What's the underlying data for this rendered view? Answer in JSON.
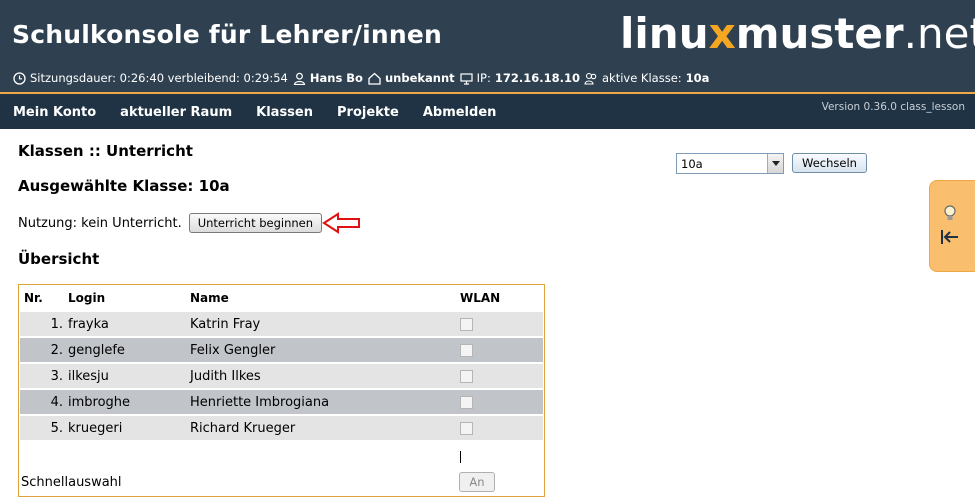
{
  "header": {
    "title": "Schulkonsole für Lehrer/innen",
    "logo": {
      "part1": "linu",
      "x": "x",
      "part2": "muster",
      "part3": ".net"
    },
    "status": {
      "session_label": "Sitzungsdauer: 0:26:40 verbleibend: 0:29:54",
      "user": "Hans Bo",
      "room": "unbekannt",
      "ip_label": "IP:",
      "ip": "172.16.18.10",
      "class_label": "aktive Klasse:",
      "class": "10a"
    }
  },
  "nav": {
    "items": [
      "Mein Konto",
      "aktueller Raum",
      "Klassen",
      "Projekte",
      "Abmelden"
    ],
    "version": "Version 0.36.0 class_lesson"
  },
  "page": {
    "title": "Klassen :: Unterricht",
    "selected_class": "Ausgewählte Klasse: 10a",
    "usage_text": "Nutzung: kein Unterricht.",
    "start_button": "Unterricht beginnen",
    "overview_heading": "Übersicht",
    "class_select_value": "10a",
    "switch_button": "Wechseln"
  },
  "table": {
    "headers": [
      "Nr.",
      "Login",
      "Name",
      "WLAN"
    ],
    "rows": [
      {
        "nr": "1.",
        "login": "frayka",
        "name": "Katrin Fray"
      },
      {
        "nr": "2.",
        "login": "genglefe",
        "name": "Felix Gengler"
      },
      {
        "nr": "3.",
        "login": "ilkesju",
        "name": "Judith Ilkes"
      },
      {
        "nr": "4.",
        "login": "imbroghe",
        "name": "Henriette Imbrogiana"
      },
      {
        "nr": "5.",
        "login": "kruegeri",
        "name": "Richard Krueger"
      }
    ],
    "quick_select_label": "Schnellauswahl",
    "quick_button": "An"
  },
  "colors": {
    "header_bg": "#2f4150",
    "nav_bg": "#1f3344",
    "accent": "#f0a845",
    "row_odd": "#e4e4e4",
    "row_even": "#c1c5c9"
  }
}
